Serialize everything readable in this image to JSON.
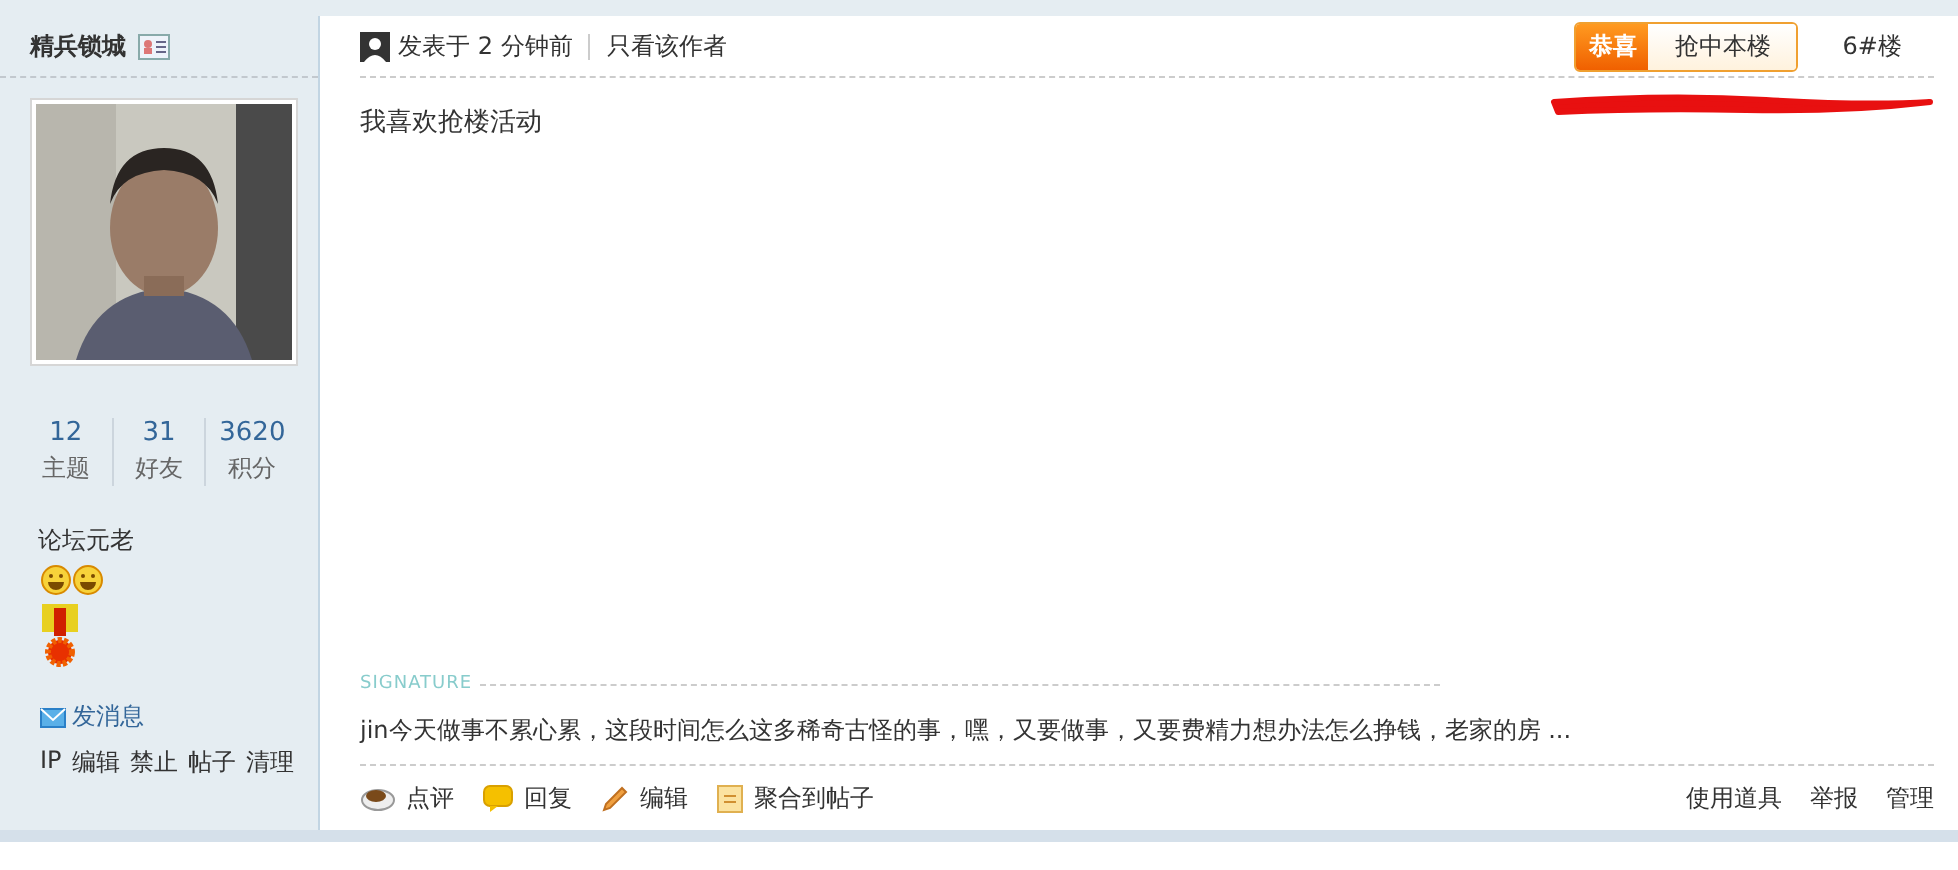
{
  "author": {
    "name": "精兵锁城",
    "stats": [
      {
        "value": "12",
        "label": "主题"
      },
      {
        "value": "31",
        "label": "好友"
      },
      {
        "value": "3620",
        "label": "积分"
      }
    ],
    "rank": "论坛元老",
    "message_link": "发消息",
    "admin_links": [
      "IP",
      "编辑",
      "禁止",
      "帖子",
      "清理"
    ]
  },
  "post": {
    "posted": "发表于 2 分钟前",
    "author_only": "只看该作者",
    "badge": {
      "prefix": "恭喜",
      "text": "抢中本楼"
    },
    "floor": "6#楼",
    "content": "我喜欢抢楼活动",
    "signature_heading": "SIGNATURE",
    "signature": "jin今天做事不累心累，这段时间怎么这多稀奇古怪的事，嘿，又要做事，又要费精力想办法怎么挣钱，老家的房 ..."
  },
  "actions": [
    {
      "kind": "comment",
      "label": "点评"
    },
    {
      "kind": "reply",
      "label": "回复"
    },
    {
      "kind": "edit",
      "label": "编辑"
    },
    {
      "kind": "merge",
      "label": "聚合到帖子"
    }
  ],
  "right_actions": [
    "使用道具",
    "举报",
    "管理"
  ]
}
